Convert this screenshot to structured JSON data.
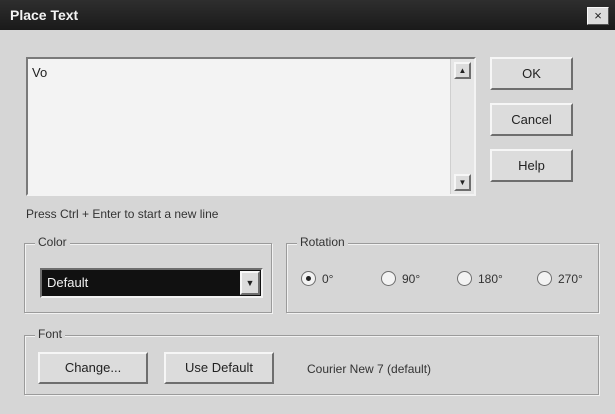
{
  "window": {
    "title": "Place Text",
    "close_glyph": "×"
  },
  "text_input": {
    "value": "Vo"
  },
  "scroll": {
    "up_glyph": "▲",
    "down_glyph": "▼"
  },
  "buttons": {
    "ok": "OK",
    "cancel": "Cancel",
    "help": "Help"
  },
  "hint": "Press Ctrl + Enter to start a new line",
  "color_group": {
    "label": "Color",
    "selected": "Default",
    "arrow_glyph": "▼"
  },
  "rotation_group": {
    "label": "Rotation",
    "options": [
      "0°",
      "90°",
      "180°",
      "270°"
    ],
    "selected": "0°"
  },
  "font_group": {
    "label": "Font",
    "change_label": "Change...",
    "use_default_label": "Use Default",
    "current_font": "Courier New 7 (default)"
  }
}
